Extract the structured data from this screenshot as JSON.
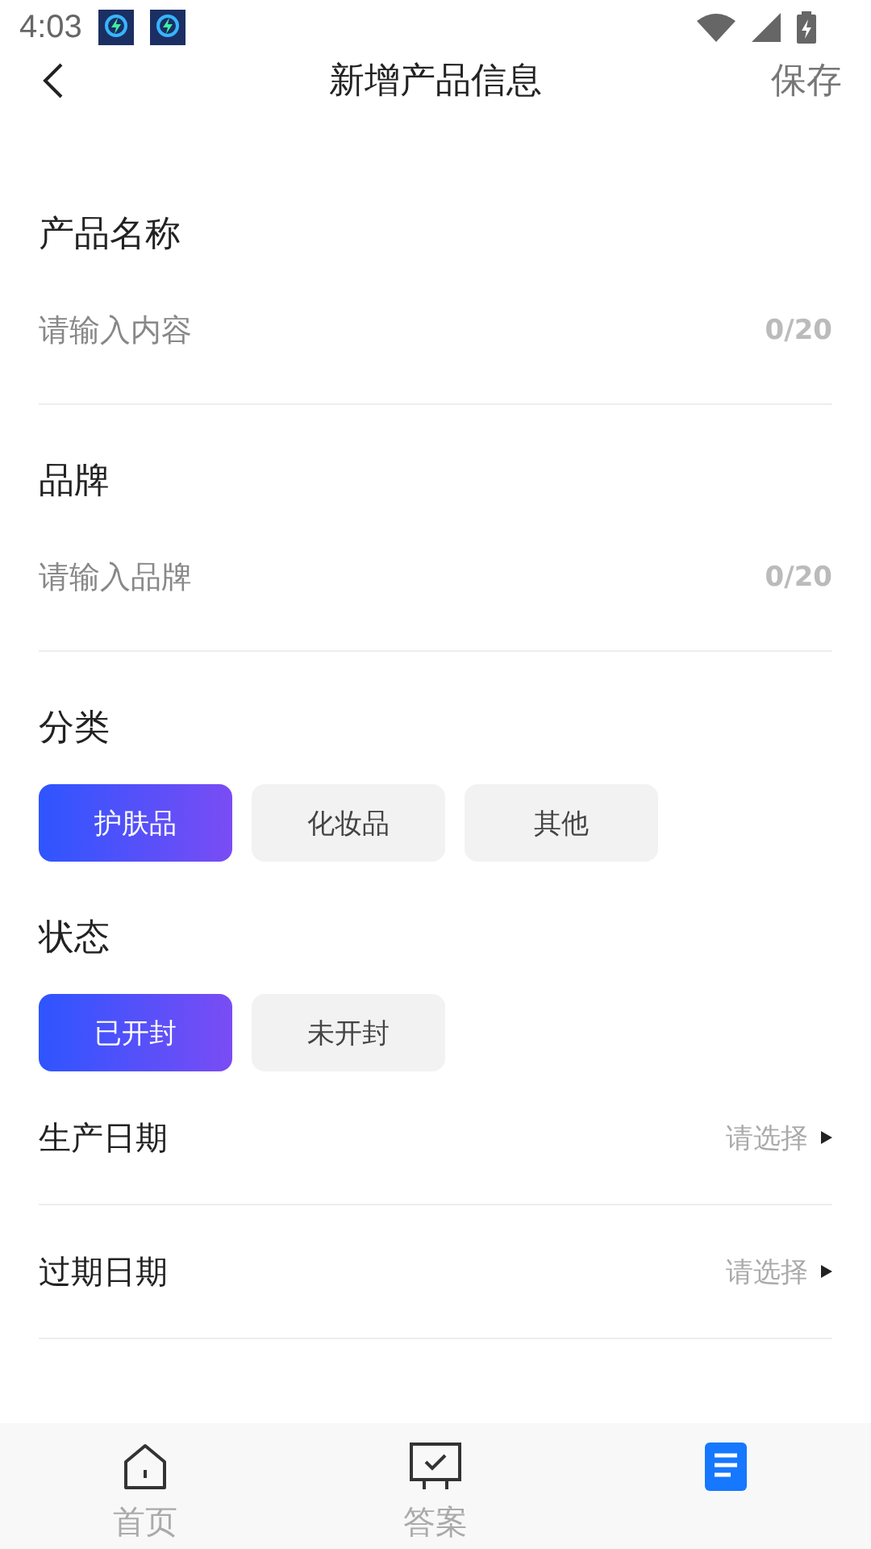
{
  "status_bar": {
    "time": "4:03",
    "notifications": [
      {
        "kind": "app"
      },
      {
        "kind": "app"
      }
    ]
  },
  "header": {
    "title": "新增产品信息",
    "action": "保存"
  },
  "fields": [
    {
      "label": "产品名称",
      "placeholder": "请输入内容",
      "counter": "0/20"
    },
    {
      "label": "品牌",
      "placeholder": "请输入品牌",
      "counter": "0/20"
    }
  ],
  "chip_groups": [
    {
      "label": "分类",
      "options": [
        {
          "label": "护肤品",
          "selected": true
        },
        {
          "label": "化妆品",
          "selected": false
        },
        {
          "label": "其他",
          "selected": false
        }
      ]
    },
    {
      "label": "状态",
      "options": [
        {
          "label": "已开封",
          "selected": true
        },
        {
          "label": "未开封",
          "selected": false
        }
      ]
    }
  ],
  "date_rows": [
    {
      "label": "生产日期",
      "value": "请选择"
    },
    {
      "label": "过期日期",
      "value": "请选择"
    }
  ],
  "tab_bar": [
    {
      "kind": "home",
      "label": "首页",
      "selected": false
    },
    {
      "kind": "answers",
      "label": "答案",
      "selected": false
    },
    {
      "kind": "list",
      "selected": true
    }
  ]
}
